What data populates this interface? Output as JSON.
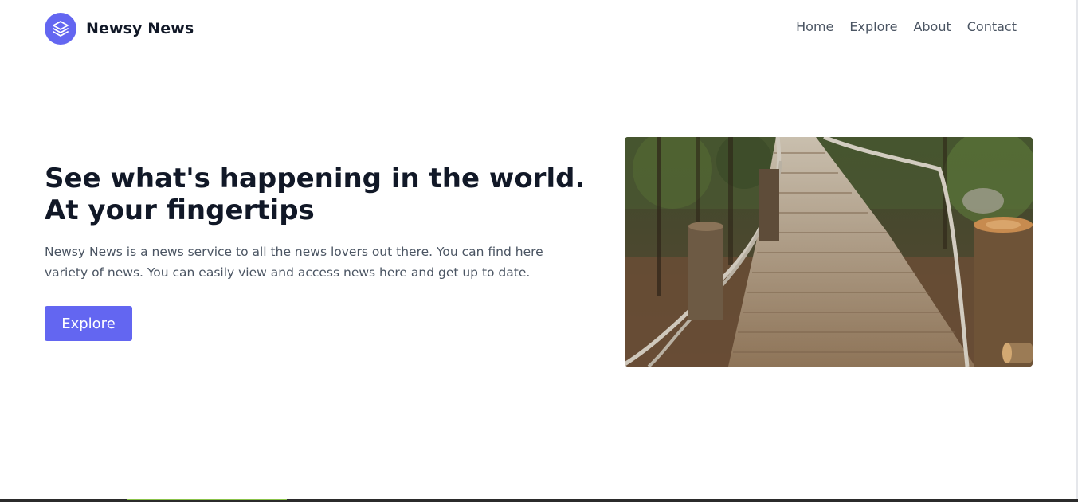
{
  "brand": {
    "name": "Newsy News",
    "logo_icon": "layers-icon",
    "accent": "#6366f1"
  },
  "nav": {
    "items": [
      "Home",
      "Explore",
      "About",
      "Contact"
    ]
  },
  "hero": {
    "title_line1": "See what's happening in the world.",
    "title_line2": "At your fingertips",
    "description": "Newsy News is a news service to all the news lovers out there. You can find here variety of news. You can easily view and access news here and get up to date.",
    "button_label": "Explore",
    "image_subject": "wooden boardwalk through forest"
  }
}
